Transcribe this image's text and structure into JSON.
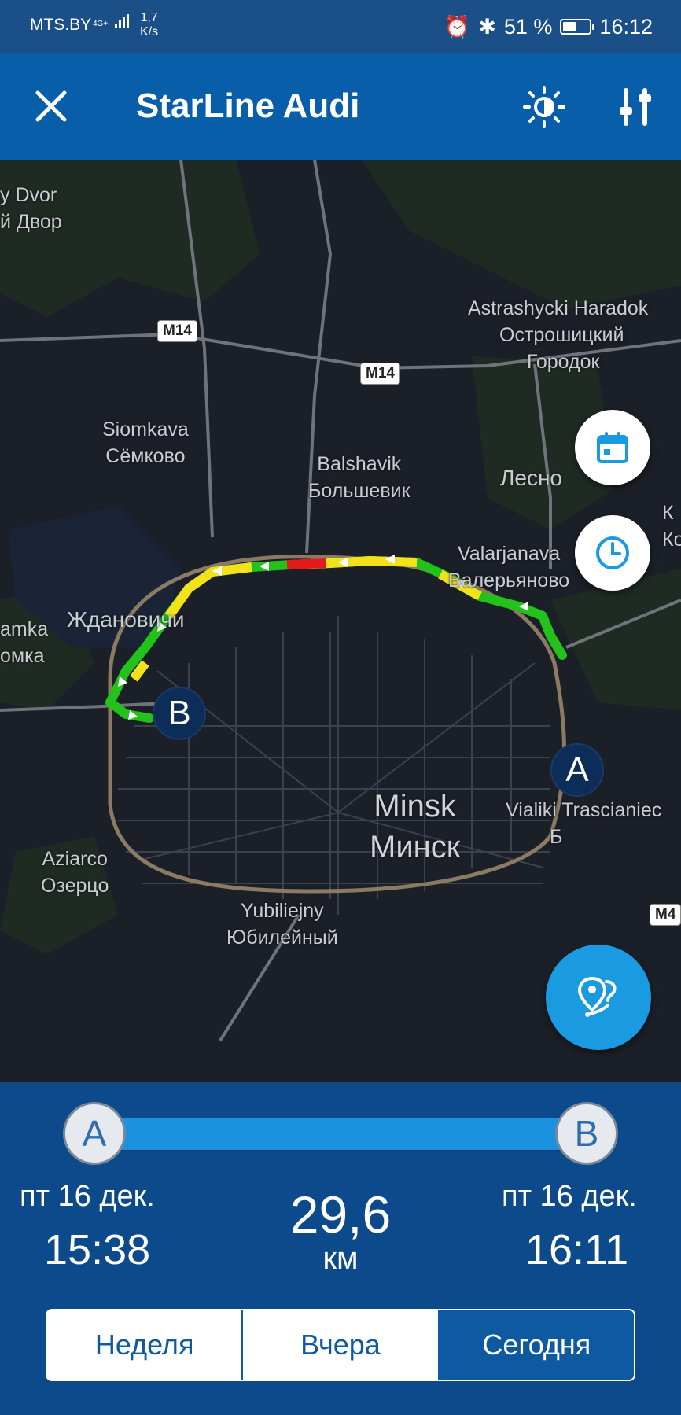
{
  "status_bar": {
    "carrier": "MTS.BY",
    "network": "4G+",
    "speed_value": "1,7",
    "speed_unit": "K/s",
    "battery": "51 %",
    "battery_level": 0.51,
    "time": "16:12"
  },
  "app_bar": {
    "title": "StarLine Audi"
  },
  "map": {
    "labels": {
      "dvor_lat": "y Dvor",
      "dvor_cyr": "й Двор",
      "astrashycki_lat": "Astrashycki Haradok",
      "astrashycki_cyr1": "Острошицкий",
      "astrashycki_cyr2": "Городок",
      "siomkava_lat": "Siomkava",
      "siomkava_cyr": "Сёмково",
      "balshavik_lat": "Balshavik",
      "balshavik_cyr": "Большевик",
      "lesno": "Лесно",
      "valarjanava_lat": "Valarjanava",
      "valarjanava_cyr": "Валерьяново",
      "zhdanovichi": "Ждановичи",
      "amka": "amka",
      "omka": "омка",
      "minsk_lat": "Minsk",
      "minsk_cyr": "Минск",
      "vialiki_lat": "Vialiki Trascianiec",
      "vialiki_cyr": "Б",
      "aziarco_lat": "Aziarco",
      "aziarco_cyr": "Озерцо",
      "yubiliejny_lat": "Yubiliejny",
      "yubiliejny_cyr": "Юбилейный",
      "edge_k": "К",
      "edge_ko": "Ко"
    },
    "road_shields": {
      "m14_west": "M14",
      "m14_center": "M14",
      "m4": "M4"
    },
    "markers": {
      "start": "A",
      "end": "B"
    }
  },
  "trip": {
    "start_marker": "A",
    "end_marker": "B",
    "start_date": "пт 16 дек.",
    "start_time": "15:38",
    "distance": "29,6",
    "distance_unit": "км",
    "end_date": "пт 16 дек.",
    "end_time": "16:11"
  },
  "period_tabs": [
    {
      "label": "Неделя",
      "active": false
    },
    {
      "label": "Вчера",
      "active": false
    },
    {
      "label": "Сегодня",
      "active": true
    }
  ],
  "colors": {
    "app_bar": "#085ea8",
    "panel": "#0d4a8c",
    "accent": "#1a9ae0",
    "route_green": "#22c21a",
    "route_yellow": "#f2e21b",
    "route_red": "#e3191b"
  }
}
